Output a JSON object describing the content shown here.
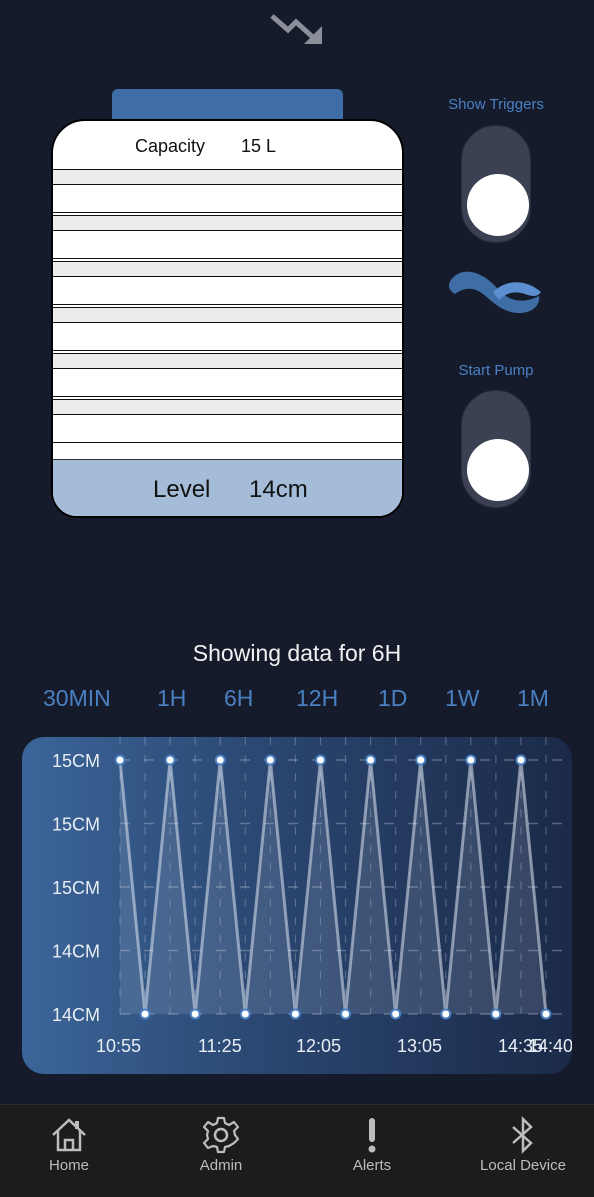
{
  "icons": {
    "trend": "trending-down-icon",
    "logo": "wave-logo-icon",
    "home": "home-icon",
    "admin": "gear-icon",
    "alerts": "exclamation-icon",
    "bluetooth": "bluetooth-icon"
  },
  "colors": {
    "background": "#151b2b",
    "accent": "#4a80c2",
    "tank_lid": "#3f6ea6",
    "water": "#a4bcd8"
  },
  "tank": {
    "capacity_label": "Capacity",
    "capacity_value": "15 L",
    "level_label": "Level",
    "level_value": "14cm"
  },
  "controls": {
    "show_triggers_label": "Show Triggers",
    "start_pump_label": "Start Pump"
  },
  "range": {
    "showing_text": "Showing data for 6H",
    "options": [
      "30MIN",
      "1H",
      "6H",
      "12H",
      "1D",
      "1W",
      "1M"
    ],
    "selected": "6H"
  },
  "chart_data": {
    "type": "line",
    "ytick_labels": [
      "15CM",
      "15CM",
      "15CM",
      "14CM",
      "14CM"
    ],
    "xtick_labels": [
      "10:55",
      "11:25",
      "12:05",
      "13:05",
      "14:35",
      "14:40"
    ],
    "series": [
      {
        "values": [
          15,
          14,
          15,
          14,
          15,
          14,
          15,
          14,
          15,
          14,
          15,
          14,
          15,
          14,
          15,
          14,
          15,
          14
        ]
      }
    ],
    "ylim": [
      14,
      15
    ],
    "grid": true
  },
  "tabbar": {
    "items": [
      {
        "label": "Home",
        "icon": "home-icon"
      },
      {
        "label": "Admin",
        "icon": "gear-icon"
      },
      {
        "label": "Alerts",
        "icon": "exclamation-icon"
      },
      {
        "label": "Local Device",
        "icon": "bluetooth-icon"
      }
    ]
  }
}
